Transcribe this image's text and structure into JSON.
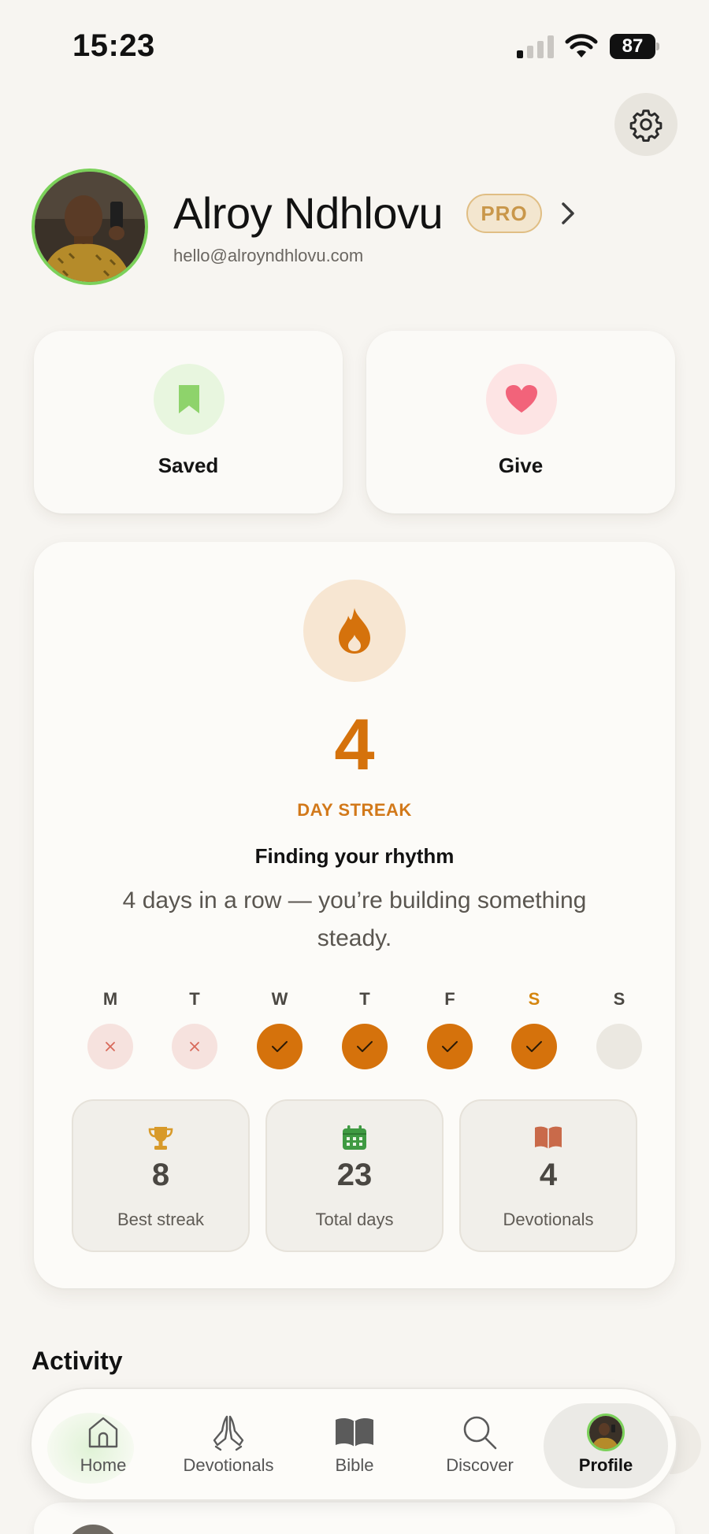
{
  "status_bar": {
    "time": "15:23",
    "battery": "87"
  },
  "profile": {
    "name": "Alroy Ndhlovu",
    "badge": "PRO",
    "email": "hello@alroyndhlovu.com"
  },
  "quick_actions": [
    {
      "label": "Saved",
      "icon": "bookmark-icon",
      "color": "#8ed36b"
    },
    {
      "label": "Give",
      "icon": "heart-icon",
      "color": "#f2637a"
    }
  ],
  "streak": {
    "count": "4",
    "label": "DAY STREAK",
    "title": "Finding your rhythm",
    "message": "4 days in a row — you’re building something steady.",
    "accent": "#d5720c",
    "days": [
      {
        "letter": "M",
        "state": "missed"
      },
      {
        "letter": "T",
        "state": "missed"
      },
      {
        "letter": "W",
        "state": "done"
      },
      {
        "letter": "T",
        "state": "done"
      },
      {
        "letter": "F",
        "state": "done"
      },
      {
        "letter": "S",
        "state": "done",
        "today": true
      },
      {
        "letter": "S",
        "state": "empty"
      }
    ],
    "stats": [
      {
        "value": "8",
        "label": "Best streak",
        "icon": "trophy-icon"
      },
      {
        "value": "23",
        "label": "Total days",
        "icon": "calendar-icon"
      },
      {
        "value": "4",
        "label": "Devotionals",
        "icon": "book-icon"
      }
    ]
  },
  "activity": {
    "title": "Activity"
  },
  "tabs": [
    {
      "label": "Home",
      "icon": "home-icon"
    },
    {
      "label": "Devotionals",
      "icon": "praying-hands-icon"
    },
    {
      "label": "Bible",
      "icon": "bible-icon"
    },
    {
      "label": "Discover",
      "icon": "search-icon"
    },
    {
      "label": "Profile",
      "icon": "avatar",
      "active": true
    }
  ]
}
